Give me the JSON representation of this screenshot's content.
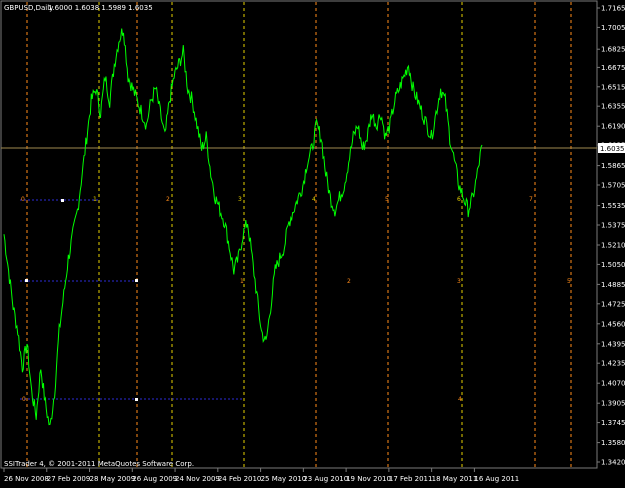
{
  "header": {
    "symbol": "GBPUSD,Daily",
    "ohlc": "1.6000 1.6038 1.5989 1.6035"
  },
  "footer": {
    "copyright": "SSITrader 4, © 2001-2011 MetaQuotes Software Corp."
  },
  "current_price": "1.6035",
  "colors": {
    "background": "#000000",
    "price_line": "#00ff00",
    "grid_text": "#ffffff",
    "price_level_line": "#a08a50",
    "vline_orange": "#ff8c1a",
    "vline_yellow": "#e6d000",
    "vline_blue": "#2b2bd9",
    "level_label_bg": "#ffffff"
  },
  "cycle_lines": [
    {
      "label": "0",
      "color": "orange"
    },
    {
      "label": "1",
      "color": "yellow"
    },
    {
      "label": "2",
      "color": "orange"
    },
    {
      "label": "3",
      "color": "yellow"
    },
    {
      "label": "4",
      "color": "yellow"
    },
    {
      "label": "5",
      "color": "orange"
    },
    {
      "label": "6",
      "color": "yellow"
    },
    {
      "label": "7",
      "color": "orange"
    }
  ],
  "secondary_labels": [
    "0",
    "1",
    "2",
    "3",
    "4",
    "5"
  ],
  "chart_data": {
    "type": "line",
    "title": "GBPUSD,Daily",
    "ylim": [
      1.342,
      1.7165
    ],
    "y_ticks": [
      "1.7165",
      "1.7005",
      "1.6825",
      "1.6675",
      "1.6515",
      "1.6355",
      "1.6190",
      "1.6035",
      "1.5865",
      "1.5705",
      "1.5535",
      "1.5375",
      "1.5210",
      "1.5050",
      "1.4885",
      "1.4725",
      "1.4560",
      "1.4395",
      "1.4235",
      "1.4070",
      "1.3905",
      "1.3745",
      "1.3580",
      "1.3420"
    ],
    "x_ticks": [
      "26 Nov 2008",
      "27 Feb 2009",
      "28 May 2009",
      "26 Aug 2009",
      "24 Nov 2009",
      "24 Feb 2010",
      "25 May 2010",
      "23 Aug 2010",
      "19 Nov 2010",
      "17 Feb 2011",
      "18 May 2011",
      "16 Aug 2011"
    ],
    "series": [
      {
        "values": [
          1.53,
          1.5,
          1.47,
          1.45,
          1.42,
          1.44,
          1.4,
          1.38,
          1.42,
          1.39,
          1.37,
          1.4,
          1.45,
          1.48,
          1.51,
          1.53,
          1.55,
          1.58,
          1.61,
          1.64,
          1.65,
          1.63,
          1.66,
          1.64,
          1.67,
          1.69,
          1.7,
          1.66,
          1.65,
          1.64,
          1.63,
          1.62,
          1.64,
          1.65,
          1.63,
          1.61,
          1.64,
          1.66,
          1.67,
          1.68,
          1.65,
          1.64,
          1.62,
          1.6,
          1.61,
          1.58,
          1.56,
          1.55,
          1.54,
          1.52,
          1.5,
          1.51,
          1.53,
          1.54,
          1.51,
          1.48,
          1.45,
          1.44,
          1.47,
          1.5,
          1.51,
          1.52,
          1.54,
          1.55,
          1.56,
          1.57,
          1.59,
          1.6,
          1.62,
          1.61,
          1.58,
          1.56,
          1.55,
          1.56,
          1.57,
          1.59,
          1.61,
          1.62,
          1.6,
          1.61,
          1.63,
          1.62,
          1.63,
          1.61,
          1.62,
          1.64,
          1.65,
          1.66,
          1.67,
          1.65,
          1.64,
          1.63,
          1.62,
          1.61,
          1.63,
          1.65,
          1.64,
          1.61,
          1.59,
          1.57,
          1.56,
          1.55,
          1.56,
          1.58,
          1.6035
        ]
      }
    ]
  }
}
